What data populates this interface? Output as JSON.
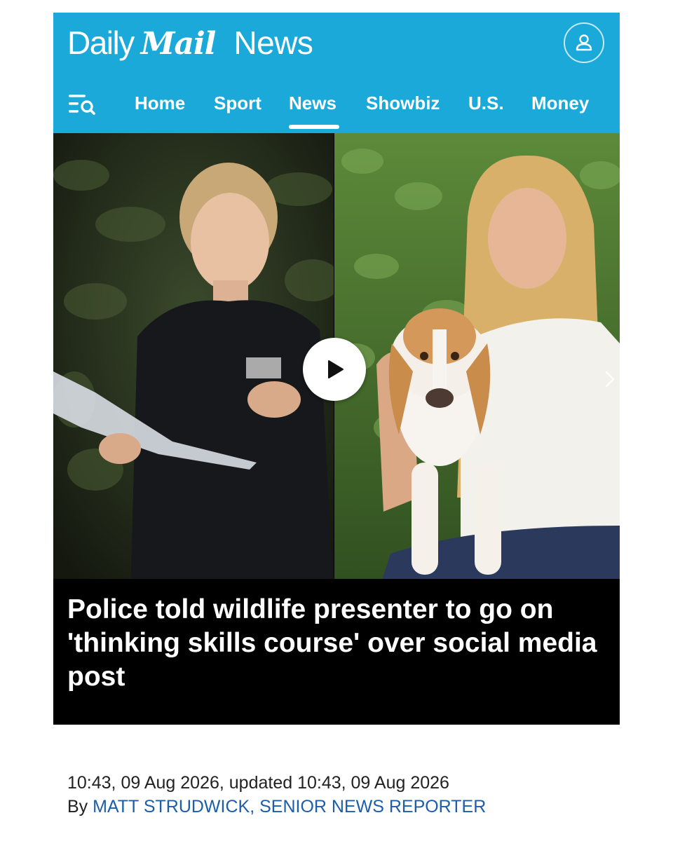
{
  "brand": {
    "daily": "Daily",
    "mail": "Mail",
    "section": "News",
    "header_color": "#1aa9d9"
  },
  "header": {
    "account_icon": "user-icon",
    "menu_icon": "menu-search-icon"
  },
  "nav": {
    "items": [
      {
        "label": "Home",
        "active": false
      },
      {
        "label": "Sport",
        "active": false
      },
      {
        "label": "News",
        "active": true
      },
      {
        "label": "Showbiz",
        "active": false
      },
      {
        "label": "U.S.",
        "active": false
      },
      {
        "label": "Money",
        "active": false
      }
    ]
  },
  "article": {
    "headline": "Police told wildlife presenter to go on 'thinking skills course' over social media post",
    "timestamp": "10:43, 09 Aug 2026, updated 10:43, 09 Aug 2026",
    "byline_prefix": "By",
    "author": "MATT STRUDWICK, SENIOR NEWS REPORTER",
    "author_color": "#1c5ea8"
  },
  "media": {
    "play_icon": "play-icon",
    "next_icon": "chevron-right-icon"
  }
}
